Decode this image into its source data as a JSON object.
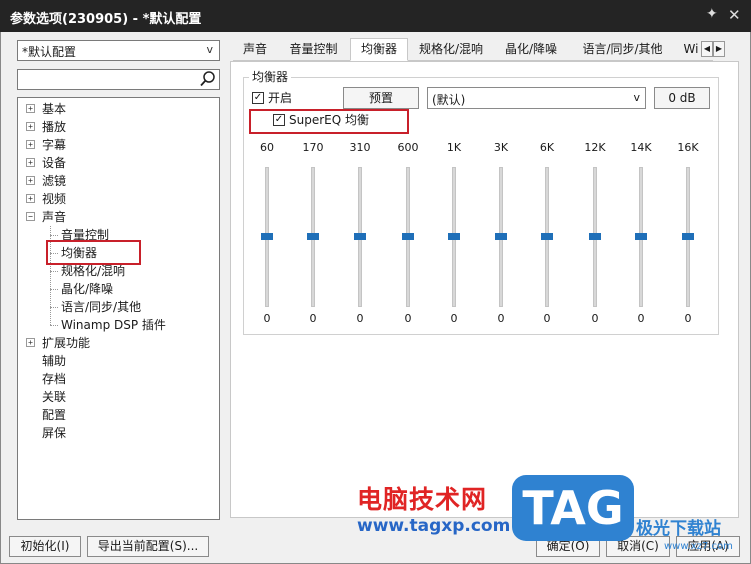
{
  "window": {
    "title": "参数选项(230905) - *默认配置"
  },
  "sidebar": {
    "profile_select": "*默认配置",
    "search_value": "",
    "tree": [
      {
        "label": "基本",
        "expander": "+"
      },
      {
        "label": "播放",
        "expander": "+"
      },
      {
        "label": "字幕",
        "expander": "+"
      },
      {
        "label": "设备",
        "expander": "+"
      },
      {
        "label": "滤镜",
        "expander": "+"
      },
      {
        "label": "视频",
        "expander": "+"
      },
      {
        "label": "声音",
        "expander": "−"
      },
      {
        "label": "音量控制",
        "expander": ""
      },
      {
        "label": "均衡器",
        "expander": ""
      },
      {
        "label": "规格化/混响",
        "expander": ""
      },
      {
        "label": "晶化/降噪",
        "expander": ""
      },
      {
        "label": "语言/同步/其他",
        "expander": ""
      },
      {
        "label": "Winamp DSP 插件",
        "expander": ""
      },
      {
        "label": "扩展功能",
        "expander": "+"
      },
      {
        "label": "辅助",
        "expander": ""
      },
      {
        "label": "存档",
        "expander": ""
      },
      {
        "label": "关联",
        "expander": ""
      },
      {
        "label": "配置",
        "expander": ""
      },
      {
        "label": "屏保",
        "expander": ""
      }
    ],
    "selected": "均衡器"
  },
  "tabs": [
    "声音",
    "音量控制",
    "均衡器",
    "规格化/混响",
    "晶化/降噪",
    "语言/同步/其他",
    "Wi"
  ],
  "active_tab": "均衡器",
  "equalizer": {
    "group_title": "均衡器",
    "enable_label": "开启",
    "enable_checked": true,
    "preset_button": "预置",
    "preset_select": "(默认)",
    "gain_button": "0 dB",
    "supereq_label": "SuperEQ 均衡",
    "supereq_checked": true,
    "bands": [
      {
        "freq": "60",
        "value": "0"
      },
      {
        "freq": "170",
        "value": "0"
      },
      {
        "freq": "310",
        "value": "0"
      },
      {
        "freq": "600",
        "value": "0"
      },
      {
        "freq": "1K",
        "value": "0"
      },
      {
        "freq": "3K",
        "value": "0"
      },
      {
        "freq": "6K",
        "value": "0"
      },
      {
        "freq": "12K",
        "value": "0"
      },
      {
        "freq": "14K",
        "value": "0"
      },
      {
        "freq": "16K",
        "value": "0"
      }
    ]
  },
  "footer": {
    "reset_button": "初始化(I)",
    "export_button": "导出当前配置(S)...",
    "ok_button": "确定(O)",
    "cancel_button": "取消(C)",
    "apply_button": "应用(A)"
  },
  "watermark": {
    "cn_text": "电脑技术网",
    "url_text": "www.tagxp.com",
    "tag_text": "TAG",
    "site_text": "极光下载站",
    "site_url": "www.xz7.com"
  },
  "colors": {
    "titlebar": "#242424",
    "highlight": "#c8202a",
    "slider_thumb": "#1f6fb8"
  }
}
